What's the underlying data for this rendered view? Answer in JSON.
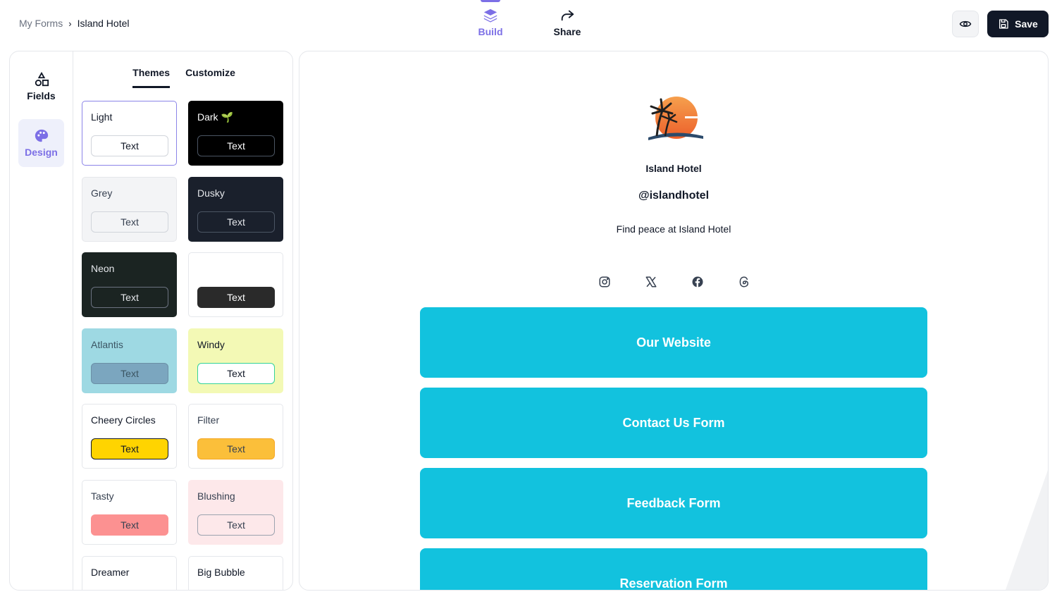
{
  "breadcrumb": {
    "root": "My Forms",
    "separator": "›",
    "current": "Island Hotel"
  },
  "nav_tabs": [
    {
      "label": "Build",
      "icon": "layers-icon"
    },
    {
      "label": "Share",
      "icon": "share-arrow-icon"
    }
  ],
  "toolbar": {
    "preview_icon": "eye-icon",
    "save_label": "Save",
    "save_icon": "floppy-disk-icon"
  },
  "rail": {
    "fields_label": "Fields",
    "fields_icon": "shapes-icon",
    "design_label": "Design",
    "design_icon": "palette-icon"
  },
  "subtabs": {
    "themes": "Themes",
    "customize": "Customize"
  },
  "themes": [
    {
      "name": "Light",
      "button": "Text",
      "bg": "#ffffff",
      "fg": "#111827",
      "btn_bg": "#ffffff",
      "btn_fg": "#111827",
      "btn_border": "#d1d5db"
    },
    {
      "name": "Dark 🌱",
      "button": "Text",
      "bg": "#000000",
      "fg": "#ffffff",
      "btn_bg": "#000000",
      "btn_fg": "#ffffff",
      "btn_border": "#4b5563"
    },
    {
      "name": "Grey",
      "button": "Text",
      "bg": "#f3f4f6",
      "fg": "#374151",
      "btn_bg": "#f3f4f6",
      "btn_fg": "#374151",
      "btn_border": "#d1d5db"
    },
    {
      "name": "Dusky",
      "button": "Text",
      "bg": "#1a202c",
      "fg": "#e5e7eb",
      "btn_bg": "#1a202c",
      "btn_fg": "#e5e7eb",
      "btn_border": "#4b5563"
    },
    {
      "name": "Neon",
      "button": "Text",
      "bg": "#1b2422",
      "fg": "#e5e7eb",
      "btn_bg": "#1b2422",
      "btn_fg": "#e5e7eb",
      "btn_border": "#6b7280"
    },
    {
      "name": "",
      "button": "Text",
      "bg": "#ffffff",
      "fg": "#111827",
      "btn_bg": "#2a2a2a",
      "btn_fg": "#ffffff",
      "btn_border": "#2a2a2a"
    },
    {
      "name": "Atlantis",
      "button": "Text",
      "bg": "#9ed9e3",
      "fg": "#3b5563",
      "btn_bg": "#7ba6bf",
      "btn_fg": "#3b5563",
      "btn_border": "#6b8fa6"
    },
    {
      "name": "Windy",
      "button": "Text",
      "bg": "#f3f9b5",
      "fg": "#111827",
      "btn_bg": "#ffffff",
      "btn_fg": "#111827",
      "btn_border": "#34d399"
    },
    {
      "name": "Cheery Circles",
      "button": "Text",
      "bg": "#ffffff",
      "fg": "#111827",
      "btn_bg": "#ffd400",
      "btn_fg": "#111827",
      "btn_border": "#111827"
    },
    {
      "name": "Filter",
      "button": "Text",
      "bg": "#ffffff",
      "fg": "#374151",
      "btn_bg": "#fbbf3a",
      "btn_fg": "#374151",
      "btn_border": "#f5a623"
    },
    {
      "name": "Tasty",
      "button": "Text",
      "bg": "#ffffff",
      "fg": "#374151",
      "btn_bg": "#fc9191",
      "btn_fg": "#374151",
      "btn_border": "#fc9191"
    },
    {
      "name": "Blushing",
      "button": "Text",
      "bg": "#fde8ea",
      "fg": "#374151",
      "btn_bg": "#fde8ea",
      "btn_fg": "#374151",
      "btn_border": "#9ca3af"
    },
    {
      "name": "Dreamer",
      "button": "",
      "bg": "#ffffff",
      "fg": "#111827",
      "btn_bg": "#ffffff",
      "btn_fg": "#111827",
      "btn_border": "#ffffff"
    },
    {
      "name": "Big Bubble",
      "button": "",
      "bg": "#ffffff",
      "fg": "#111827",
      "btn_bg": "#ffffff",
      "btn_fg": "#111827",
      "btn_border": "#ffffff"
    }
  ],
  "profile": {
    "name": "Island Hotel",
    "handle": "@islandhotel",
    "description": "Find peace at Island Hotel",
    "logo_icon": "island-sunset-logo"
  },
  "socials": [
    {
      "icon": "instagram-icon"
    },
    {
      "icon": "x-twitter-icon"
    },
    {
      "icon": "facebook-icon"
    },
    {
      "icon": "threads-icon"
    }
  ],
  "links": [
    {
      "label": "Our Website"
    },
    {
      "label": "Contact Us Form"
    },
    {
      "label": "Feedback Form"
    },
    {
      "label": "Reservation Form"
    }
  ],
  "colors": {
    "accent": "#7c6fe6",
    "link_button_bg": "#12c2de",
    "save_bg": "#111827"
  }
}
